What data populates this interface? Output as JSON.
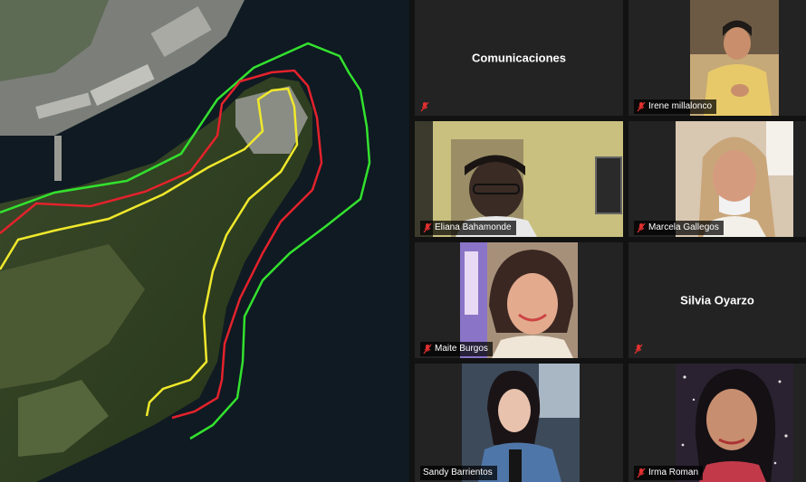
{
  "map": {
    "colors": {
      "water": "#0f1a22",
      "land": "#2c3a22",
      "green_line": "#33e12e",
      "red_line": "#e4222c",
      "yellow_line": "#efe82c"
    }
  },
  "participants": [
    {
      "name": "Comunicaciones",
      "video": false,
      "muted": true
    },
    {
      "name": "Irene millalonco",
      "video": true,
      "muted": true
    },
    {
      "name": "Eliana Bahamonde",
      "video": true,
      "muted": true
    },
    {
      "name": "Marcela Gallegos",
      "video": true,
      "muted": true
    },
    {
      "name": "Maite Burgos",
      "video": true,
      "muted": true
    },
    {
      "name": "Silvia Oyarzo",
      "video": false,
      "muted": true
    },
    {
      "name": "Sandy Barrientos",
      "video": true,
      "muted": false
    },
    {
      "name": "Irma Roman",
      "video": true,
      "muted": true
    }
  ],
  "icons": {
    "muted": "mic-muted-icon"
  },
  "colors": {
    "muted_red": "#e0302f",
    "tile_bg": "#232323"
  }
}
